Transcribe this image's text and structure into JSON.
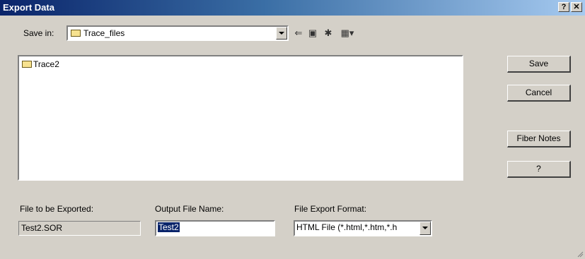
{
  "window": {
    "title": "Export Data",
    "help_button": "?",
    "close_button": "✕"
  },
  "save_in": {
    "label": "Save in:",
    "value": "Trace_files"
  },
  "toolbar": {
    "back_icon": "back-arrow-icon",
    "up_icon": "up-folder-icon",
    "new_folder_icon": "new-folder-icon",
    "view_icon": "view-menu-icon"
  },
  "file_list": {
    "items": [
      {
        "name": "Trace2"
      }
    ]
  },
  "buttons": {
    "save": "Save",
    "cancel": "Cancel",
    "fiber_notes": "Fiber Notes",
    "help": "?"
  },
  "export": {
    "file_label": "File to be Exported:",
    "file_value": "Test2.SOR",
    "output_label": "Output File Name:",
    "output_value": "Test2",
    "format_label": "File Export Format:",
    "format_value": "HTML File (*.html,*.htm,*.h"
  }
}
